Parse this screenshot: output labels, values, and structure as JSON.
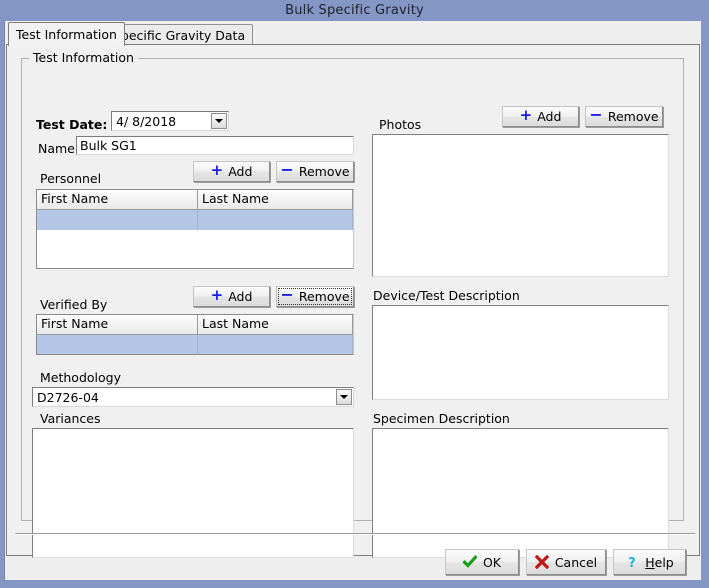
{
  "window": {
    "title": "Bulk Specific Gravity",
    "titlebar_color": "#8496c4",
    "face_color": "#f0f0f0"
  },
  "tabs": [
    {
      "label": "Test Information",
      "active": true
    },
    {
      "label": "Specific Gravity Data",
      "active": false
    }
  ],
  "group": {
    "title": "Test Information"
  },
  "fields": {
    "test_date_label": "Test Date:",
    "test_date_value": "4/  8/2018",
    "name_label": "Name:",
    "name_value": "Bulk SG1",
    "methodology_label": "Methodology",
    "methodology_value": "D2726-04",
    "variances_label": "Variances",
    "variances_value": ""
  },
  "personnel": {
    "label": "Personnel",
    "add_label": "Add",
    "remove_label": "Remove",
    "plus_glyph": "+",
    "minus_glyph": "−",
    "columns": [
      "First Name",
      "Last Name"
    ],
    "rows": [
      {
        "first": "",
        "last": "",
        "selected": true
      }
    ]
  },
  "verified_by": {
    "label": "Verified By",
    "add_label": "Add",
    "remove_label": "Remove",
    "plus_glyph": "+",
    "minus_glyph": "−",
    "columns": [
      "First Name",
      "Last Name"
    ],
    "rows": [
      {
        "first": "",
        "last": "",
        "selected": true
      }
    ]
  },
  "photos": {
    "label": "Photos",
    "add_label": "Add",
    "remove_label": "Remove",
    "plus_glyph": "+",
    "minus_glyph": "−",
    "content": ""
  },
  "device_description": {
    "label": "Device/Test Description",
    "value": ""
  },
  "specimen_description": {
    "label": "Specimen Description",
    "value": ""
  },
  "footer": {
    "ok_label": "OK",
    "cancel_label": "Cancel",
    "help_label_prefix": "H",
    "help_label_rest": "elp",
    "ok_icon_color": "#18a018",
    "cancel_icon_color": "#c01818",
    "help_icon_color": "#1fb4d6"
  }
}
